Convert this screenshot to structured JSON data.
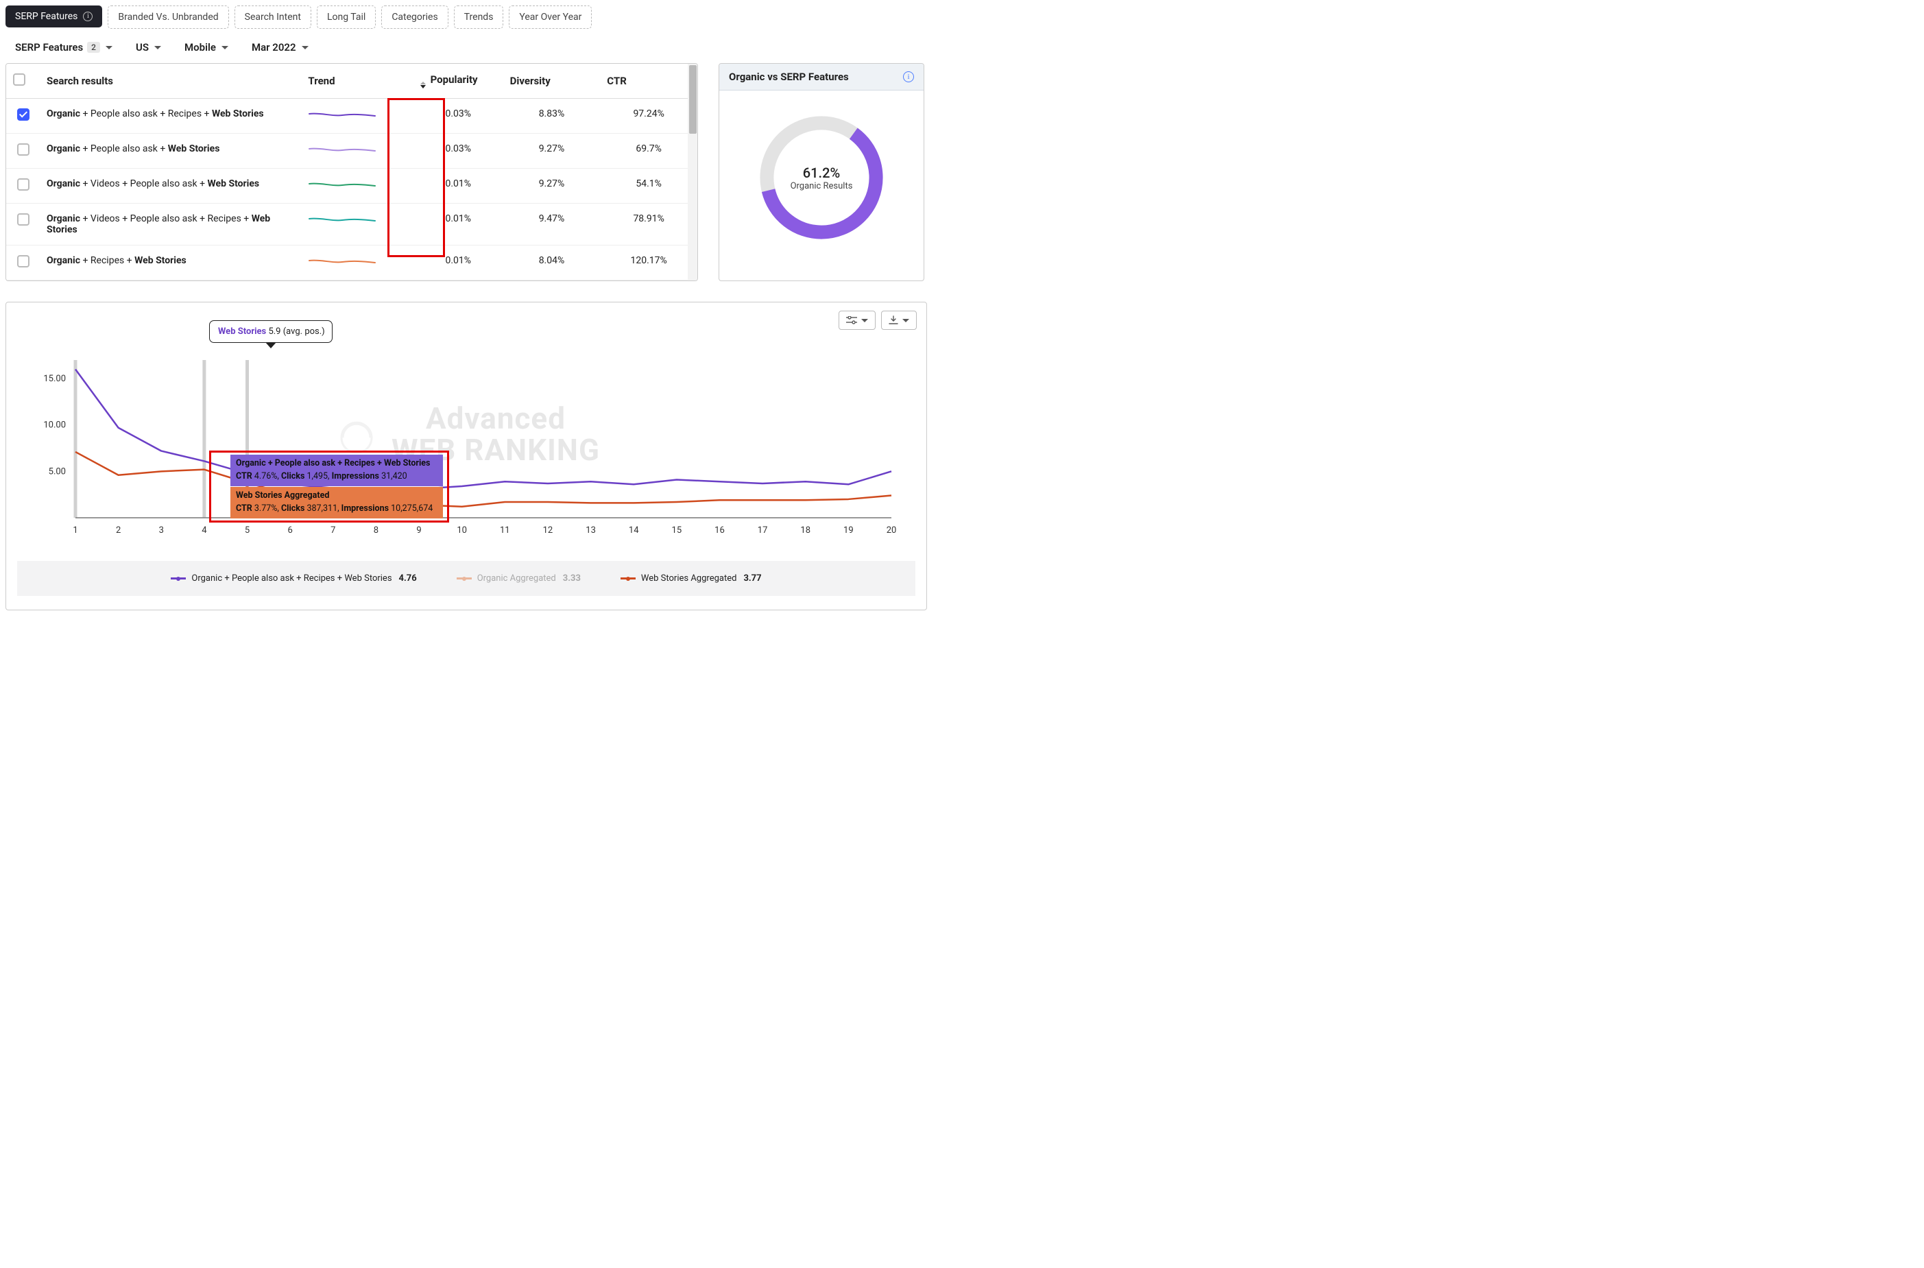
{
  "tabs": {
    "active": "SERP Features",
    "ghosts": [
      "Branded Vs. Unbranded",
      "Search Intent",
      "Long Tail",
      "Categories",
      "Trends",
      "Year Over Year"
    ]
  },
  "filters": {
    "serp_features": {
      "label": "SERP Features",
      "count": "2"
    },
    "market": "US",
    "device": "Mobile",
    "date": "Mar 2022"
  },
  "table": {
    "headers": {
      "search_results": "Search results",
      "trend": "Trend",
      "popularity": "Popularity",
      "diversity": "Diversity",
      "ctr": "CTR"
    },
    "rows": [
      {
        "checked": true,
        "name_parts": [
          {
            "t": "Organic",
            "b": true
          },
          {
            "t": " + People also ask + Recipes + ",
            "b": false
          },
          {
            "t": "Web Stories",
            "b": true
          }
        ],
        "spark_color": "#6a3fc6",
        "popularity": "0.03%",
        "diversity": "8.83%",
        "ctr": "97.24%"
      },
      {
        "checked": false,
        "name_parts": [
          {
            "t": "Organic",
            "b": true
          },
          {
            "t": " + People also ask + ",
            "b": false
          },
          {
            "t": "Web Stories",
            "b": true
          }
        ],
        "spark_color": "#a98adf",
        "popularity": "0.03%",
        "diversity": "9.27%",
        "ctr": "69.7%"
      },
      {
        "checked": false,
        "name_parts": [
          {
            "t": "Organic",
            "b": true
          },
          {
            "t": " + Videos + People also ask + ",
            "b": false
          },
          {
            "t": "Web Stories",
            "b": true
          }
        ],
        "spark_color": "#29a06b",
        "popularity": "0.01%",
        "diversity": "9.27%",
        "ctr": "54.1%"
      },
      {
        "checked": false,
        "name_parts": [
          {
            "t": "Organic",
            "b": true
          },
          {
            "t": " + Videos + People also ask + Recipes + ",
            "b": false
          },
          {
            "t": "Web Stories",
            "b": true
          }
        ],
        "spark_color": "#1aa7a0",
        "popularity": "0.01%",
        "diversity": "9.47%",
        "ctr": "78.91%"
      },
      {
        "checked": false,
        "name_parts": [
          {
            "t": "Organic",
            "b": true
          },
          {
            "t": " + Recipes + ",
            "b": false
          },
          {
            "t": "Web Stories",
            "b": true
          }
        ],
        "spark_color": "#e57a45",
        "popularity": "0.01%",
        "diversity": "8.04%",
        "ctr": "120.17%"
      }
    ]
  },
  "organic_card": {
    "title": "Organic vs SERP Features",
    "percent": "61.2%",
    "label": "Organic Results",
    "donut_value": 61.2
  },
  "tooltip": {
    "title": "Web Stories",
    "value": "5.9",
    "suffix": "(avg. pos.)"
  },
  "watermark": {
    "l1": "Advanced",
    "l2": "WEB RANKING"
  },
  "callouts": {
    "purple": {
      "line1": "Organic + People also ask + Recipes + Web Stories",
      "ctr_l": "CTR",
      "ctr_v": "4.76%",
      "clicks_l": "Clicks",
      "clicks_v": "1,495",
      "imp_l": "Impressions",
      "imp_v": "31,420"
    },
    "orange": {
      "line1": "Web Stories Aggregated",
      "ctr_l": "CTR",
      "ctr_v": "3.77%",
      "clicks_l": "Clicks",
      "clicks_v": "387,311",
      "imp_l": "Impressions",
      "imp_v": "10,275,674"
    }
  },
  "legend": {
    "a": {
      "label": "Organic + People also ask + Recipes + Web Stories",
      "val": "4.76",
      "color": "#6a3fc6"
    },
    "b": {
      "label": "Organic Aggregated",
      "val": "3.33",
      "color": "#e57a45",
      "dim": true
    },
    "c": {
      "label": "Web Stories Aggregated",
      "val": "3.77",
      "color": "#cf4a1d"
    }
  },
  "chart_data": {
    "type": "line",
    "xlabel": "",
    "ylabel": "",
    "x": [
      1,
      2,
      3,
      4,
      5,
      6,
      7,
      8,
      9,
      10,
      11,
      12,
      13,
      14,
      15,
      16,
      17,
      18,
      19,
      20
    ],
    "xlim": [
      1,
      20
    ],
    "ylim": [
      0,
      17
    ],
    "y_ticks": [
      5.0,
      10.0,
      15.0
    ],
    "hover_x": 5,
    "vrules_x": [
      1,
      4,
      5
    ],
    "series": [
      {
        "name": "Organic + People also ask + Recipes + Web Stories",
        "color": "#6a3fc6",
        "values": [
          16.0,
          9.7,
          7.2,
          6.1,
          4.76,
          3.6,
          3.2,
          3.0,
          3.1,
          3.4,
          3.9,
          3.7,
          3.9,
          3.6,
          4.1,
          3.9,
          3.7,
          3.9,
          3.6,
          5.0
        ]
      },
      {
        "name": "Web Stories Aggregated",
        "color": "#cf4a1d",
        "values": [
          7.1,
          4.6,
          5.0,
          5.2,
          3.77,
          2.5,
          1.8,
          1.6,
          1.4,
          1.2,
          1.7,
          1.7,
          1.6,
          1.6,
          1.7,
          1.9,
          1.9,
          1.9,
          2.0,
          2.4
        ]
      }
    ]
  }
}
